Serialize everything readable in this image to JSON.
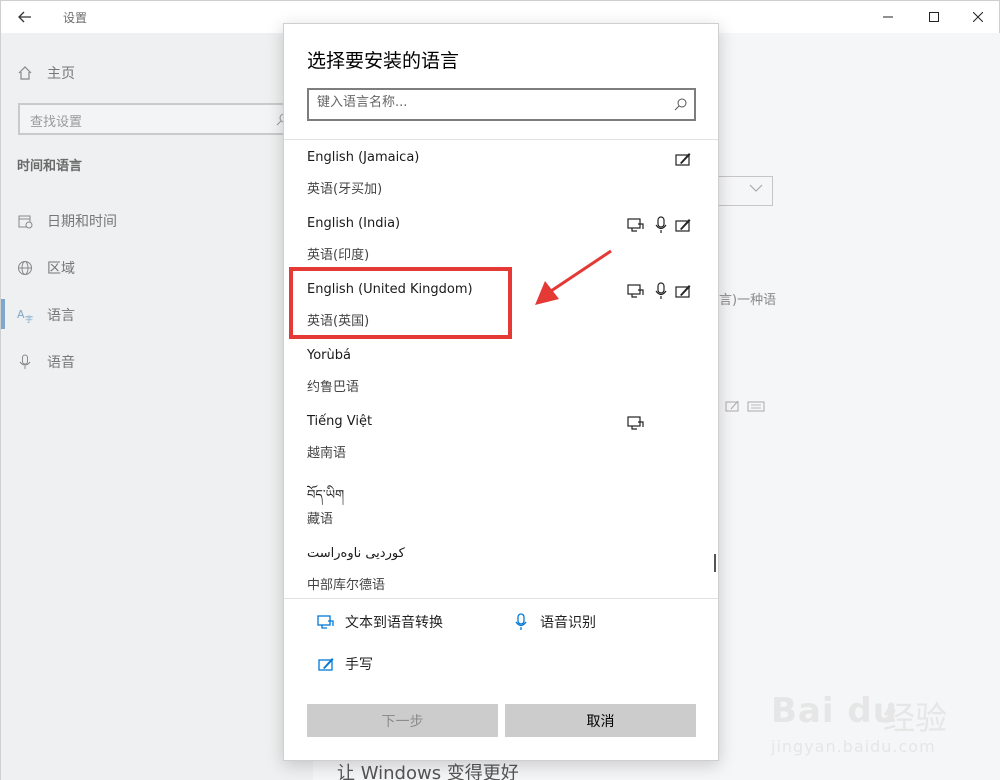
{
  "window": {
    "title": "设置"
  },
  "sidebar": {
    "home": "主页",
    "search_placeholder": "查找设置",
    "section": "时间和语言",
    "items": [
      {
        "label": "日期和时间",
        "icon": "calendar-clock-icon"
      },
      {
        "label": "区域",
        "icon": "globe-icon"
      },
      {
        "label": "语言",
        "icon": "language-icon",
        "active": true
      },
      {
        "label": "语音",
        "icon": "microphone-icon"
      }
    ]
  },
  "background": {
    "partial_text": "言)一种语",
    "footer": "让 Windows 变得更好"
  },
  "dialog": {
    "title": "选择要安装的语言",
    "search_placeholder": "键入语言名称...",
    "languages": [
      {
        "name": "English (Jamaica)",
        "native": "英语(牙买加)",
        "tts": false,
        "speech": false,
        "handwriting": true
      },
      {
        "name": "English (India)",
        "native": "英语(印度)",
        "tts": true,
        "speech": true,
        "handwriting": true
      },
      {
        "name": "English (United Kingdom)",
        "native": "英语(英国)",
        "tts": true,
        "speech": true,
        "handwriting": true,
        "highlighted": true
      },
      {
        "name": "Yorùbá",
        "native": "约鲁巴语",
        "tts": false,
        "speech": false,
        "handwriting": false
      },
      {
        "name": "Tiếng Việt",
        "native": "越南语",
        "tts": true,
        "speech": false,
        "handwriting": false
      },
      {
        "name": "བོད་ཡིག",
        "native": "藏语",
        "tts": false,
        "speech": false,
        "handwriting": false
      },
      {
        "name": "کوردیی ناوەراست",
        "native": "中部库尔德语",
        "tts": false,
        "speech": false,
        "handwriting": false
      }
    ],
    "legend": {
      "tts": "文本到语音转换",
      "speech": "语音识别",
      "handwriting": "手写"
    },
    "next_button": "下一步",
    "cancel_button": "取消"
  },
  "watermark": {
    "brand": "Bai du",
    "cn": "经验",
    "url": "jingyan.baidu.com"
  },
  "colors": {
    "accent": "#0078d7",
    "annotation": "#e53935"
  }
}
